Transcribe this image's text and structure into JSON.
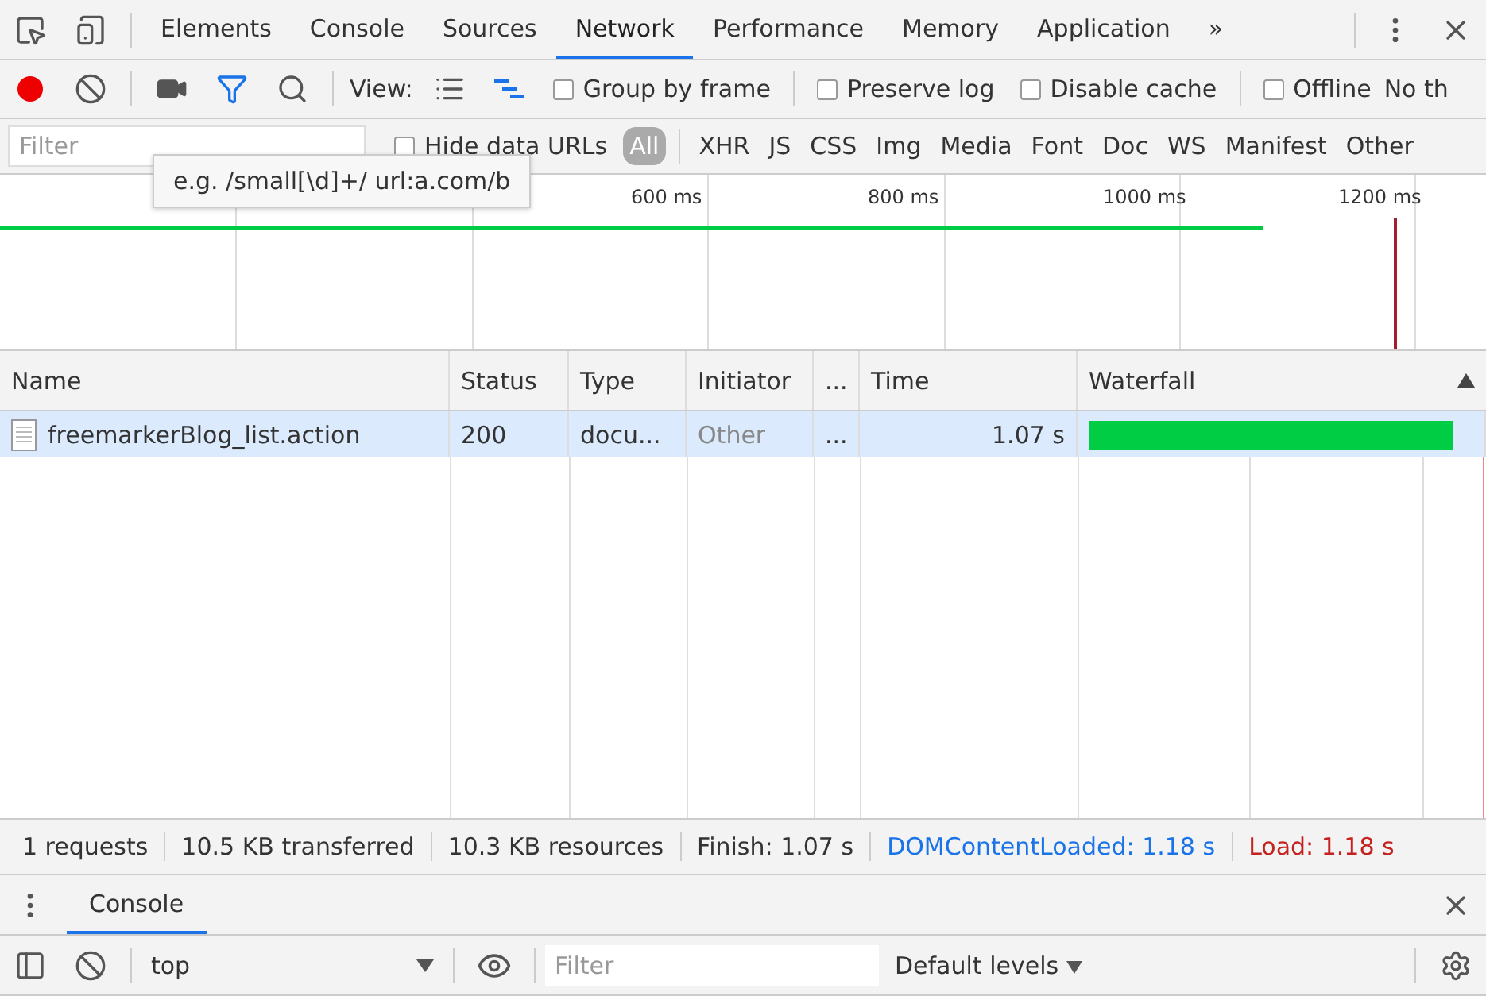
{
  "tabs": [
    {
      "label": "Elements",
      "selected": false
    },
    {
      "label": "Console",
      "selected": false
    },
    {
      "label": "Sources",
      "selected": false
    },
    {
      "label": "Network",
      "selected": true
    },
    {
      "label": "Performance",
      "selected": false
    },
    {
      "label": "Memory",
      "selected": false
    },
    {
      "label": "Application",
      "selected": false
    }
  ],
  "more_tabs": "»",
  "toolbar": {
    "recording": true,
    "filter_active": true,
    "view_label": "View:",
    "options": [
      {
        "label": "Group by frame",
        "checked": false
      },
      {
        "label": "Preserve log",
        "checked": false
      },
      {
        "label": "Disable cache",
        "checked": false
      },
      {
        "label": "Offline",
        "checked": false
      }
    ],
    "throttle": "No th"
  },
  "filter": {
    "placeholder": "Filter",
    "hide_data_urls": {
      "label": "Hide data URLs",
      "checked": false
    },
    "types": [
      {
        "label": "All",
        "selected": true
      },
      {
        "label": "XHR",
        "selected": false
      },
      {
        "label": "JS",
        "selected": false
      },
      {
        "label": "CSS",
        "selected": false
      },
      {
        "label": "Img",
        "selected": false
      },
      {
        "label": "Media",
        "selected": false
      },
      {
        "label": "Font",
        "selected": false
      },
      {
        "label": "Doc",
        "selected": false
      },
      {
        "label": "WS",
        "selected": false
      },
      {
        "label": "Manifest",
        "selected": false
      },
      {
        "label": "Other",
        "selected": false
      }
    ]
  },
  "tooltip": "e.g. /small[\\d]+/ url:a.com/b",
  "overview": {
    "ticks": [
      "600 ms",
      "800 ms",
      "1000 ms",
      "1200 ms"
    ]
  },
  "table": {
    "columns": [
      "Name",
      "Status",
      "Type",
      "Initiator",
      "...",
      "Time",
      "Waterfall"
    ],
    "rows": [
      {
        "name": "freemarkerBlog_list.action",
        "status": "200",
        "type": "docu...",
        "initiator": "Other",
        "column_5": "...",
        "time": "1.07 s",
        "selected": true
      }
    ]
  },
  "status_bar": [
    {
      "text": "1 requests",
      "kind": "plain"
    },
    {
      "text": "10.5 KB transferred",
      "kind": "plain"
    },
    {
      "text": "10.3 KB resources",
      "kind": "plain"
    },
    {
      "text": "Finish: 1.07 s",
      "kind": "plain"
    },
    {
      "text": "DOMContentLoaded: 1.18 s",
      "kind": "dom"
    },
    {
      "text": "Load: 1.18 s",
      "kind": "load"
    }
  ],
  "drawer": {
    "tabs": [
      {
        "label": "Console",
        "selected": true
      }
    ],
    "context": "top",
    "filter_placeholder": "Filter",
    "levels": "Default levels"
  }
}
